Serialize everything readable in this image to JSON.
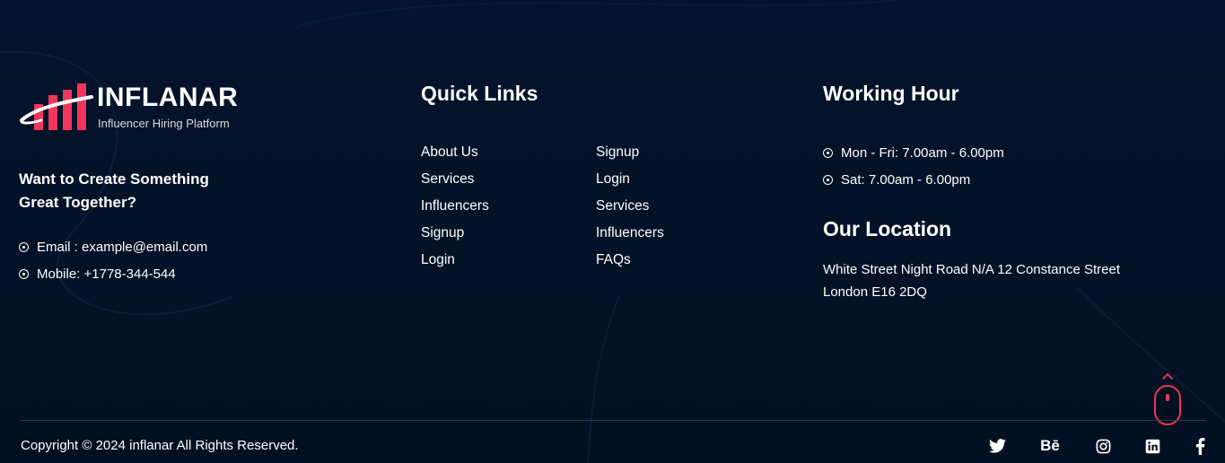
{
  "brand": {
    "name": "INFLANAR",
    "tagline": "Influencer Hiring Platform"
  },
  "cta": {
    "heading": "Want to Create Something Great Together?"
  },
  "contact": {
    "email": "Email : example@email.com",
    "mobile": "Mobile: +1778-344-544"
  },
  "quick_links": {
    "heading": "Quick Links",
    "column1": [
      "About Us",
      "Services",
      "Influencers",
      "Signup",
      "Login"
    ],
    "column2": [
      "Signup",
      "Login",
      "Services",
      "Influencers",
      "FAQs"
    ]
  },
  "working_hours": {
    "heading": "Working Hour",
    "items": [
      "Mon - Fri: 7.00am - 6.00pm",
      "Sat: 7.00am - 6.00pm"
    ]
  },
  "location": {
    "heading": "Our Location",
    "address": "White Street Night Road N/A 12 Constance Street London E16 2DQ"
  },
  "footer": {
    "copyright": "Copyright © 2024 inflanar All Rights Reserved."
  },
  "social": {
    "behance_label": "Bē",
    "icons": [
      "twitter-icon",
      "behance-icon",
      "instagram-icon",
      "linkedin-icon",
      "facebook-icon"
    ]
  },
  "colors": {
    "accent": "#f0365a",
    "background": "#031226",
    "divider": "#2a3a55"
  }
}
